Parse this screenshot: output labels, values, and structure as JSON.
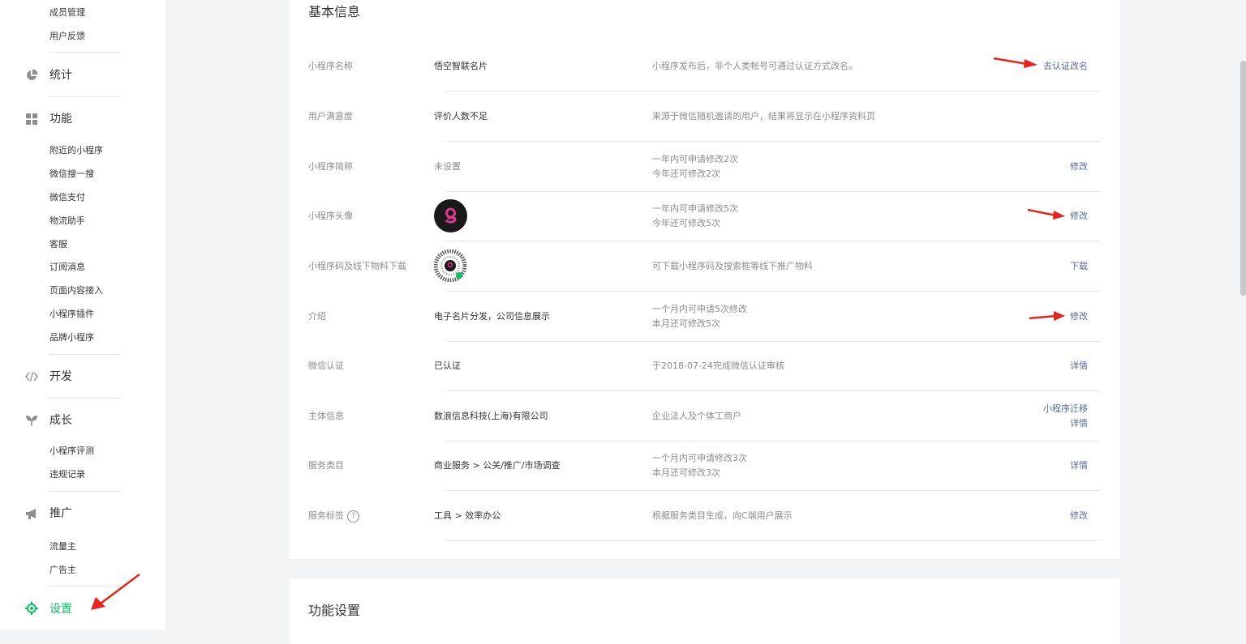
{
  "sidebar": {
    "top_items": [
      "成员管理",
      "用户反馈"
    ],
    "stats_label": "统计",
    "features_label": "功能",
    "features_items": [
      "附近的小程序",
      "微信搜一搜",
      "微信支付",
      "物流助手",
      "客服",
      "订阅消息",
      "页面内容接入",
      "小程序插件",
      "品牌小程序"
    ],
    "dev_label": "开发",
    "growth_label": "成长",
    "growth_items": [
      "小程序评测",
      "违规记录"
    ],
    "promo_label": "推广",
    "promo_items": [
      "流量主",
      "广告主"
    ],
    "settings_label": "设置",
    "icons": [
      "pie-chart-icon",
      "grid-icon",
      "code-icon",
      "sprout-icon",
      "megaphone-icon",
      "gear-icon"
    ]
  },
  "basic": {
    "title": "基本信息",
    "rows": [
      {
        "label": "小程序名称",
        "value": "悟空智联名片",
        "desc": [
          "小程序发布后，非个人类帐号可通过认证方式改名。"
        ],
        "actions": [
          "去认证改名"
        ]
      },
      {
        "label": "用户满意度",
        "value": "评价人数不足",
        "desc": [
          "来源于微信随机邀请的用户，结果将显示在小程序资料页"
        ],
        "actions": []
      },
      {
        "label": "小程序简称",
        "value": "未设置",
        "desc": [
          "一年内可申请修改2次",
          "今年还可修改2次"
        ],
        "actions": [
          "修改"
        ]
      },
      {
        "label": "小程序头像",
        "value": "",
        "desc": [
          "一年内可申请修改5次",
          "今年还可修改5次"
        ],
        "actions": [
          "修改"
        ]
      },
      {
        "label": "小程序码及线下物料下载",
        "value": "",
        "desc": [
          "可下载小程序码及搜索框等线下推广物料"
        ],
        "actions": [
          "下载"
        ]
      },
      {
        "label": "介绍",
        "value": "电子名片分发，公司信息展示",
        "desc": [
          "一个月内可申请5次修改",
          "本月还可修改5次"
        ],
        "actions": [
          "修改"
        ]
      },
      {
        "label": "微信认证",
        "value": "已认证",
        "desc": [
          "于2018-07-24完成微信认证审核"
        ],
        "actions": [
          "详情"
        ]
      },
      {
        "label": "主体信息",
        "value": "数浪信息科技(上海)有限公司",
        "desc": [
          "企业法人及个体工商户"
        ],
        "actions": [
          "小程序迁移",
          "详情"
        ]
      },
      {
        "label": "服务类目",
        "value": "商业服务 > 公关/推广/市场调查",
        "desc": [
          "一个月内可申请修改3次",
          "本月还可修改3次"
        ],
        "actions": [
          "详情"
        ]
      },
      {
        "label": "服务标签",
        "value": "工具 > 效率办公",
        "desc": [
          "根据服务类目生成，向C端用户展示"
        ],
        "actions": [
          "修改"
        ]
      }
    ],
    "help_glyph": "?"
  },
  "func": {
    "title": "功能设置"
  },
  "colors": {
    "link": "#576b95",
    "active": "#07c160",
    "annotation_arrow": "#e8231d"
  }
}
